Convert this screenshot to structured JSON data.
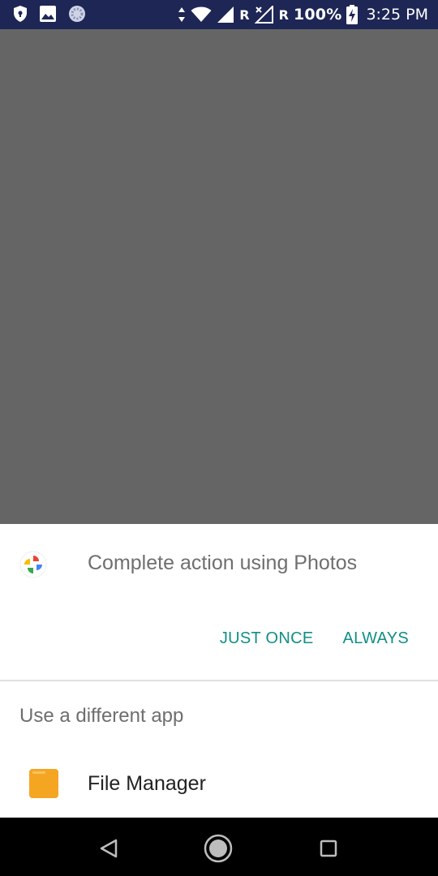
{
  "status_bar": {
    "network_label_1": "R",
    "network_label_2": "R",
    "battery": "100%",
    "time": "3:25 PM"
  },
  "dialog": {
    "title": "Complete action using Photos",
    "just_once": "JUST ONCE",
    "always": "ALWAYS",
    "section_label": "Use a different app",
    "apps": [
      {
        "label": "File Manager"
      }
    ]
  },
  "colors": {
    "status_bar_bg": "#1d2655",
    "scrim": "#656565",
    "accent": "#118f85",
    "nav_bg": "#000000",
    "file_manager_icon": "#f4a623"
  },
  "icons": {
    "status_left": [
      "vpn-shield-icon",
      "image-icon",
      "sync-circle-icon"
    ],
    "status_right": [
      "data-arrows-icon",
      "wifi-icon",
      "signal-icon",
      "signal-noservice-icon",
      "battery-charging-icon"
    ],
    "dialog_app": "google-photos-pinwheel-icon",
    "list_app": "file-manager-folder-icon",
    "nav": [
      "back-icon",
      "home-icon",
      "recents-icon"
    ]
  }
}
